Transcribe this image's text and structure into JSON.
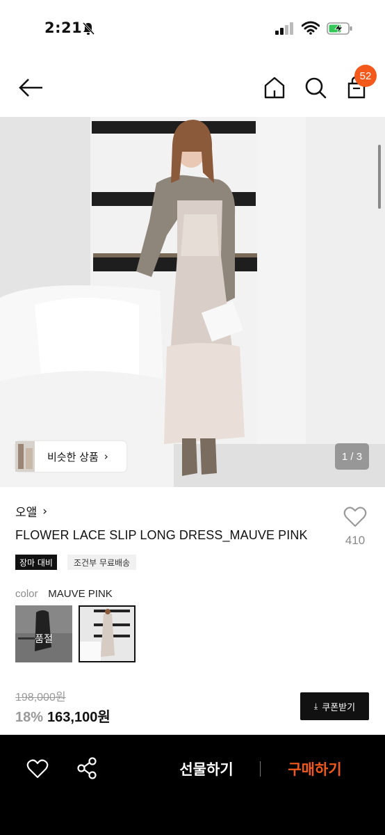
{
  "status_bar": {
    "time": "2:21"
  },
  "header": {
    "cart_count": "52"
  },
  "hero": {
    "similar_label": "비슷한 상품",
    "similar_chevron": "›",
    "pager": "1 / 3"
  },
  "product": {
    "brand": "오앨",
    "brand_chevron": "›",
    "name": "FLOWER LACE SLIP LONG DRESS_MAUVE PINK",
    "like_count": "410",
    "tags": [
      "장마 대비",
      "조건부 무료배송"
    ],
    "color_label": "color",
    "color_value": "MAUVE PINK",
    "swatches": [
      {
        "soldout_label": "품절"
      }
    ],
    "original_price": "198,000원",
    "discount": "18%",
    "price": "163,100원",
    "coupon_label": "쿠폰받기",
    "coupon_icon": "⤓"
  },
  "bottom_bar": {
    "gift_label": "선물하기",
    "buy_label": "구매하기"
  },
  "colors": {
    "accent": "#f3591b",
    "black": "#000000"
  }
}
